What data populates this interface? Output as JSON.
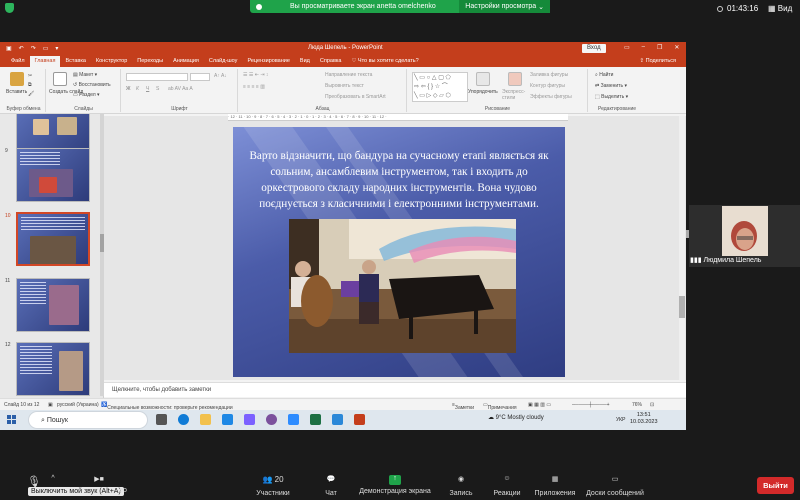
{
  "zoom": {
    "share_banner_text": "Вы просматриваете экран anetta omelchenko",
    "share_options": "Настройки просмотра",
    "timer": "01:43:16",
    "view_label": "Вид",
    "participant_name": "Людмила Шепель",
    "participants_count": "20",
    "toolbar": {
      "participants": "Участники",
      "chat": "Чат",
      "share_screen": "Демонстрация экрана",
      "record": "Запись",
      "reactions": "Реакции",
      "apps": "Приложения",
      "whiteboards": "Доски сообщений",
      "leave": "Выйти",
      "mute_tooltip": "Выключить мой звук (Alt+A)",
      "video_partial": "ео"
    },
    "colors": {
      "share_green": "#1fa34a",
      "leave_red": "#d32a2a"
    }
  },
  "ppt": {
    "window_title": "Люда Шепель  -  PowerPoint",
    "login": "Вход",
    "tabs": [
      "Файл",
      "Главная",
      "Вставка",
      "Конструктор",
      "Переходы",
      "Анимация",
      "Слайд-шоу",
      "Рецензирование",
      "Вид",
      "Справка"
    ],
    "active_tab": "Главная",
    "tell_me": "Что вы хотите сделать?",
    "share": "Поделиться",
    "ribbon": {
      "clipboard": {
        "paste": "Вставить",
        "group": "Буфер обмена"
      },
      "slides": {
        "new_slide": "Создать слайд",
        "layout": "Макет",
        "reset": "Восстановить",
        "section": "Раздел",
        "group": "Слайды"
      },
      "font": {
        "bold": "Ж",
        "italic": "К",
        "underline": "Ч",
        "strike": "S",
        "group": "Шрифт"
      },
      "paragraph": {
        "text_direction": "Направление текста",
        "align_text": "Выровнять текст",
        "smartart": "Преобразовать в SmartArt",
        "group": "Абзац"
      },
      "drawing": {
        "arrange": "Упорядочить",
        "quick_styles": "Экспресс-стили",
        "fill": "Заливка фигуры",
        "outline": "Контур фигуры",
        "effects": "Эффекты фигуры",
        "group": "Рисование"
      },
      "editing": {
        "find": "Найти",
        "replace": "Заменить",
        "select": "Выделить",
        "group": "Редактирование"
      }
    },
    "thumbnails": [
      {
        "num": "9"
      },
      {
        "num": "10"
      },
      {
        "num": "11"
      },
      {
        "num": "12"
      }
    ],
    "selected_slide": "10",
    "slide_text": "Варто відзначити, що бандура на сучасному етапі являється як сольним, ансамблевим інструментом, так і входить до оркестрового складу народних інструментів. Вона чудово поєднується з класичними і електронними інструментами.",
    "notes_placeholder": "Щелкните, чтобы добавить заметки",
    "status": {
      "slide_of": "Слайд 10 из 12",
      "language": "русский (Украина)",
      "accessibility": "Специальные возможности: проверьте рекомендации",
      "notes": "Заметки",
      "comments": "Примечания",
      "zoom": "76%"
    },
    "ruler_text": "· 12 · 11 · 10 · 9 · 8 · 7 · 6 · 5 · 4 · 3 · 2 · 1 · 0 · 1 · 2 · 3 · 4 · 5 · 6 · 7 · 8 · 9 · 10 · 11 · 12 ·"
  },
  "taskbar": {
    "search": "Пошук",
    "weather": "9°C  Mostly cloudy",
    "lang": "УКР",
    "time": "13:51",
    "date": "10.03.2023"
  }
}
